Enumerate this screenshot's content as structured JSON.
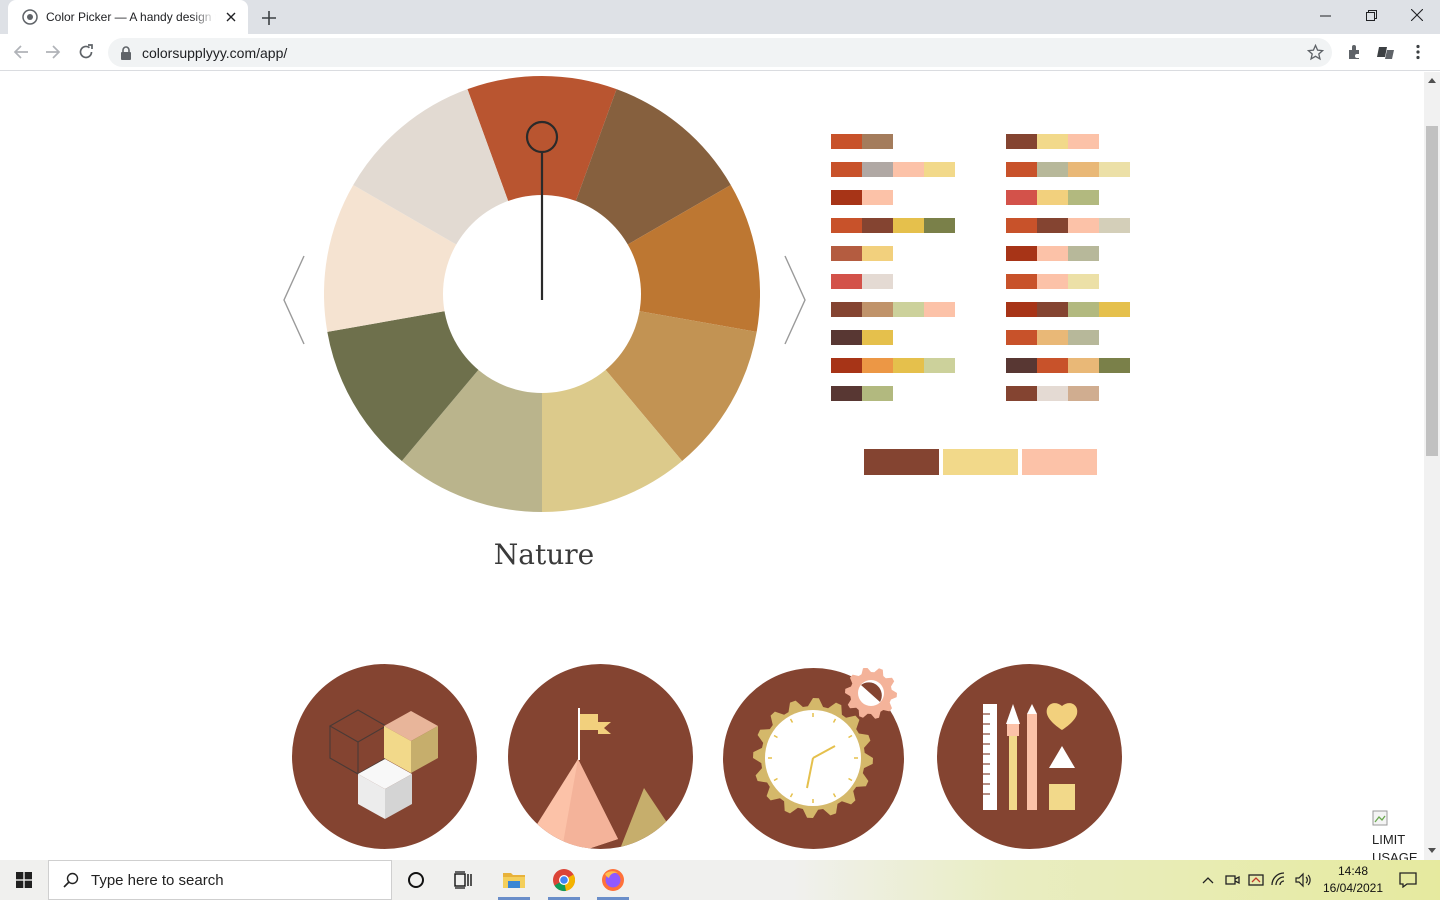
{
  "browser": {
    "tab_title": "Color Picker — A handy design tool",
    "url": "colorsupplyyy.com/app/"
  },
  "wheel": {
    "segments": [
      "#b95530",
      "#86603e",
      "#bd7732",
      "#c29353",
      "#dcca8b",
      "#bab48c",
      "#6e704c",
      "#f5e3d1",
      "#e2dad2"
    ],
    "theme_name": "Nature"
  },
  "palettes": {
    "left": [
      [
        "#c8522a",
        "#a47c5c"
      ],
      [
        "#c8522a",
        "#b0a8a4",
        "#fcc2a8",
        "#f2d98a"
      ],
      [
        "#a73417",
        "#fcc2a8"
      ],
      [
        "#c8522a",
        "#844431",
        "#e5c04c",
        "#7a8049"
      ],
      [
        "#b45c40",
        "#f2d07d"
      ],
      [
        "#d3524a",
        "#e4dad3"
      ],
      [
        "#844431",
        "#c0936a",
        "#ccd19b",
        "#fcc2a8"
      ],
      [
        "#583733",
        "#e5c04c"
      ],
      [
        "#a73417",
        "#ec9745",
        "#e5c04c",
        "#ccd19b"
      ],
      [
        "#583733",
        "#b2b97f"
      ]
    ],
    "right": [
      [
        "#844431",
        "#f2d98a",
        "#fcc2a8"
      ],
      [
        "#c8522a",
        "#b7b89a",
        "#e9b877",
        "#ece0a7"
      ],
      [
        "#d3524a",
        "#f2d07d",
        "#b2b97f"
      ],
      [
        "#c8522a",
        "#844431",
        "#fcc2a8",
        "#d4cfb9"
      ],
      [
        "#a73417",
        "#fcc2a8",
        "#b7b89a"
      ],
      [
        "#c8522a",
        "#fcc2a8",
        "#ece0a7"
      ],
      [
        "#a73417",
        "#844431",
        "#b2b97f",
        "#e5c04c"
      ],
      [
        "#c8522a",
        "#e9b877",
        "#b7b89a"
      ],
      [
        "#583733",
        "#c8522a",
        "#e9b877",
        "#7a8049"
      ],
      [
        "#844431",
        "#e4dad3",
        "#d0ad90"
      ]
    ],
    "selected": [
      "#844431",
      "#f2d98a",
      "#fcc2a8"
    ]
  },
  "overlay": {
    "limit_alt": "LIMIT USAGE"
  },
  "taskbar": {
    "search_placeholder": "Type here to search",
    "time": "14:48",
    "date": "16/04/2021"
  }
}
